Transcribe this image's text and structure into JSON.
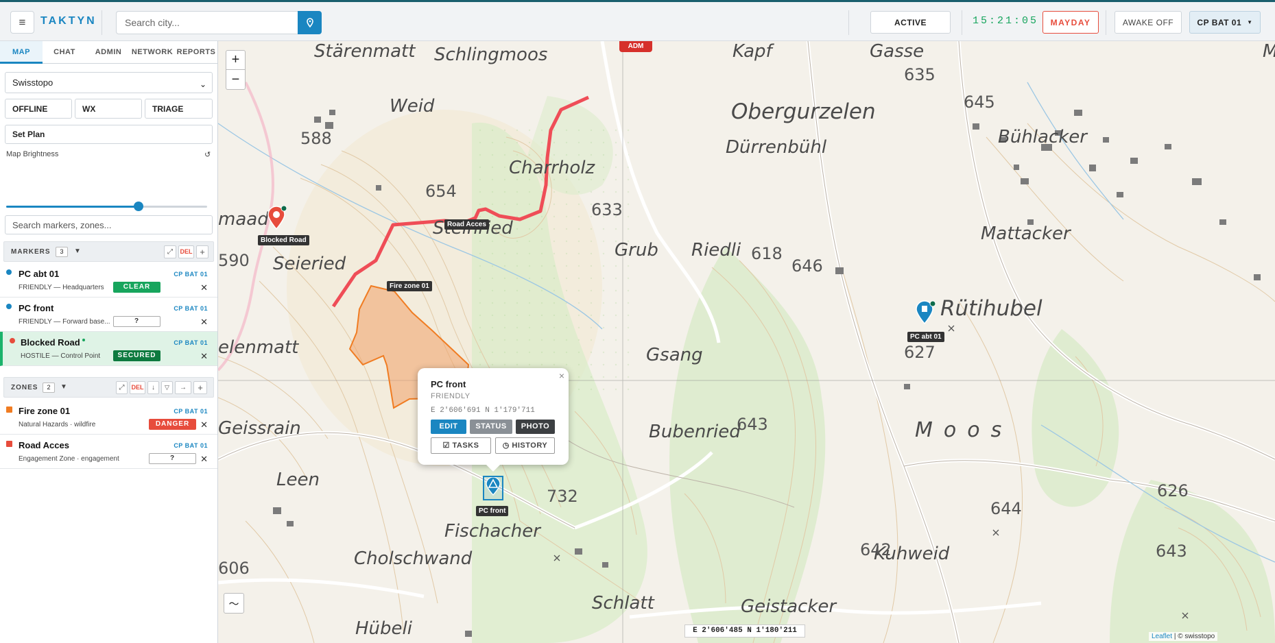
{
  "header": {
    "brand": "TAKTYN",
    "search_placeholder": "Search city...",
    "status": "ACTIVE",
    "clock": "15:21:05",
    "mayday": "MAYDAY",
    "awake": "AWAKE OFF",
    "unit": "CP BAT 01"
  },
  "sidebar": {
    "tabs": [
      "MAP",
      "CHAT",
      "ADMIN",
      "NETWORK",
      "REPORTS"
    ],
    "basemap": "Swisstopo",
    "buttons": [
      "OFFLINE",
      "WX",
      "TRIAGE"
    ],
    "set_plan": "Set Plan",
    "brightness_label": "Map Brightness",
    "brightness_value": 0.66,
    "search_placeholder": "Search markers, zones...",
    "markers": {
      "title": "MARKERS",
      "count": "3",
      "del": "DEL",
      "items": [
        {
          "name": "PC abt 01",
          "sub": "FRIENDLY — Headquarters",
          "unit": "CP BAT 01",
          "badge": "CLEAR",
          "color": "#1a86c1"
        },
        {
          "name": "PC front",
          "sub": "FRIENDLY — Forward base...",
          "unit": "CP BAT 01",
          "badge": "?",
          "color": "#1a86c1"
        },
        {
          "name": "Blocked Road",
          "sub": "HOSTILE — Control Point",
          "unit": "CP BAT 01",
          "badge": "SECURED",
          "color": "#e74c3c"
        }
      ]
    },
    "zones": {
      "title": "ZONES",
      "count": "2",
      "del": "DEL",
      "items": [
        {
          "name": "Fire zone 01",
          "sub": "Natural Hazards · wildfire",
          "unit": "CP BAT 01",
          "badge": "DANGER",
          "color": "#f07c22"
        },
        {
          "name": "Road Acces",
          "sub": "Engagement Zone · engagement",
          "unit": "CP BAT 01",
          "badge": "?",
          "color": "#e74c3c"
        }
      ]
    }
  },
  "map": {
    "adm_tag": "ADM",
    "labels": {
      "blocked_road": "Blocked Road",
      "road_acces": "Road Acces",
      "fire_zone": "Fire zone 01",
      "pc_abt": "PC abt 01",
      "pc_front": "PC front"
    },
    "places": [
      "Stärenmatt",
      "Schlingmoos",
      "Obergurzelen",
      "Dürrenbühl",
      "Bühlacker",
      "Weid",
      "Charrholz",
      "Steinried",
      "Grub",
      "Riedli",
      "Mattacker",
      "Seieried",
      "Rütihubel",
      "Gsang",
      "Bubenried",
      "Geissrain",
      "Leen",
      "Fischacher",
      "Cholschwand",
      "Schlatt",
      "Geistacker",
      "Kuhweid",
      "Hübeli",
      "Moos",
      "Kapf",
      "Gasse",
      "maad",
      "elenmatt",
      "Moos"
    ],
    "heights": [
      "588",
      "654",
      "633",
      "618",
      "646",
      "635",
      "645",
      "590",
      "627",
      "643",
      "732",
      "642",
      "644",
      "626",
      "643",
      "606"
    ],
    "popup": {
      "title": "PC front",
      "affiliation": "FRIENDLY",
      "coords": "E 2'606'691 N 1'179'711",
      "edit": "EDIT",
      "status": "STATUS",
      "photo": "PHOTO",
      "tasks": "TASKS",
      "history": "HISTORY",
      "close": "×"
    },
    "cursor_coords": "E 2'606'485 N 1'180'211",
    "attribution_link": "Leaflet",
    "attribution_text": "| © swisstopo",
    "zoom_in": "+",
    "zoom_out": "−"
  },
  "colors": {
    "accent": "#1a86c1",
    "clear": "#17a55d",
    "secured": "#0d7a3f",
    "danger": "#e74c3c",
    "mayday": "#e74c3c",
    "route": "#ef4d57",
    "fire_zone": "#f0a26a"
  }
}
